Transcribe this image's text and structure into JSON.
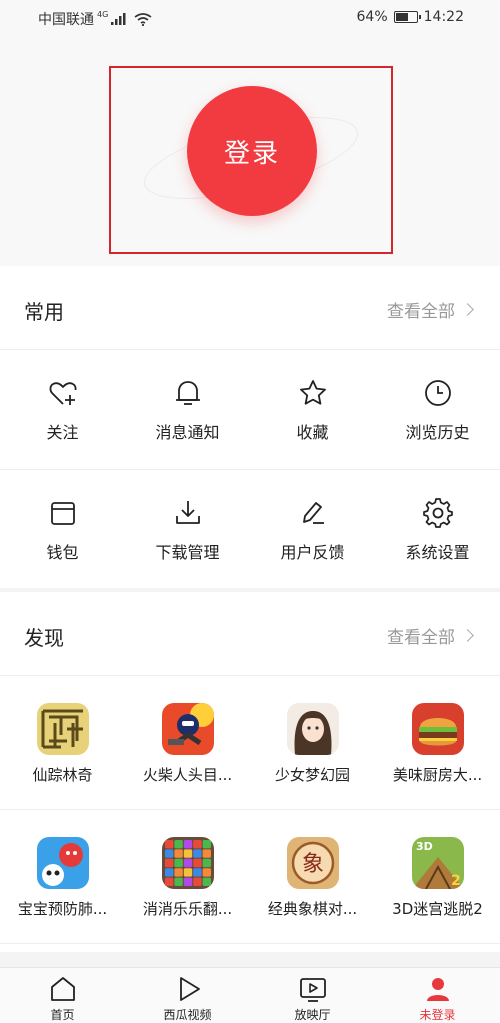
{
  "status_bar": {
    "carrier": "中国联通",
    "network": "4G",
    "battery": "64%",
    "battery_level": 0.64,
    "time": "14:22"
  },
  "header": {
    "login_label": "登录"
  },
  "common": {
    "title": "常用",
    "view_all": "查看全部",
    "rows": [
      [
        {
          "label": "关注",
          "icon": "heart-plus-icon"
        },
        {
          "label": "消息通知",
          "icon": "bell-icon"
        },
        {
          "label": "收藏",
          "icon": "star-icon"
        },
        {
          "label": "浏览历史",
          "icon": "clock-icon"
        }
      ],
      [
        {
          "label": "钱包",
          "icon": "wallet-icon"
        },
        {
          "label": "下载管理",
          "icon": "download-icon"
        },
        {
          "label": "用户反馈",
          "icon": "pencil-icon"
        },
        {
          "label": "系统设置",
          "icon": "gear-icon"
        }
      ]
    ]
  },
  "discover": {
    "title": "发现",
    "view_all": "查看全部",
    "games": [
      [
        {
          "label": "仙踪林奇",
          "icon": "maze-game-icon"
        },
        {
          "label": "火柴人头目...",
          "icon": "stickman-game-icon"
        },
        {
          "label": "少女梦幻园",
          "icon": "girl-game-icon"
        },
        {
          "label": "美味厨房大...",
          "icon": "burger-game-icon"
        }
      ],
      [
        {
          "label": "宝宝预防肺...",
          "icon": "panda-game-icon"
        },
        {
          "label": "消消乐乐翻...",
          "icon": "blocks-game-icon"
        },
        {
          "label": "经典象棋对...",
          "icon": "chess-game-icon",
          "glyph": "象"
        },
        {
          "label": "3D迷宫逃脱2",
          "icon": "maze3d-game-icon",
          "badge": "2",
          "corner": "3D"
        }
      ]
    ]
  },
  "tabs": [
    {
      "label": "首页",
      "icon": "home-icon",
      "active": false
    },
    {
      "label": "西瓜视频",
      "icon": "play-icon",
      "active": false
    },
    {
      "label": "放映厅",
      "icon": "tv-play-icon",
      "active": false
    },
    {
      "label": "未登录",
      "icon": "user-icon",
      "active": true
    }
  ],
  "colors": {
    "accent": "#f23b40",
    "frame": "#d4262c",
    "active_tab": "#e8383d"
  }
}
